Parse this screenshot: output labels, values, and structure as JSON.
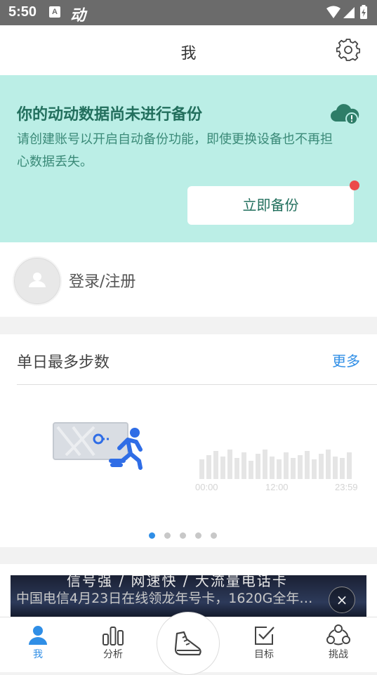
{
  "status_bar": {
    "time": "5:50",
    "notification_badge": "A",
    "app_glyph": "动"
  },
  "header": {
    "title": "我"
  },
  "backup_banner": {
    "title": "你的动动数据尚未进行备份",
    "description": "请创建账号以开启自动备份功能，即使更换设备也不再担心数据丢失。",
    "button_label": "立即备份"
  },
  "login": {
    "label": "登录/注册"
  },
  "steps_card": {
    "title": "单日最多步数",
    "more_label": "更多",
    "chart_ticks": [
      "00:00",
      "12:00",
      "23:59"
    ],
    "page_count": 5,
    "active_page": 1
  },
  "ad": {
    "banner_text": "信号强 / 网速快 / 大流量电话卡",
    "headline": "中国电信4月23日在线领龙年号卡，1620G全年…",
    "close_label": "×"
  },
  "tab_bar": {
    "tabs": [
      {
        "label": "我",
        "icon": "person-icon",
        "active": true
      },
      {
        "label": "分析",
        "icon": "bar-chart-icon",
        "active": false
      },
      {
        "label": "",
        "icon": "sneaker-icon",
        "active": false
      },
      {
        "label": "目标",
        "icon": "target-check-icon",
        "active": false
      },
      {
        "label": "挑战",
        "icon": "challenge-group-icon",
        "active": false
      }
    ]
  },
  "colors": {
    "accent_blue": "#2f8ee6",
    "banner_bg": "#bbeee6",
    "banner_text": "#226f5d",
    "alert_red": "#ec4b4b",
    "status_bar": "#6b6b6b"
  }
}
